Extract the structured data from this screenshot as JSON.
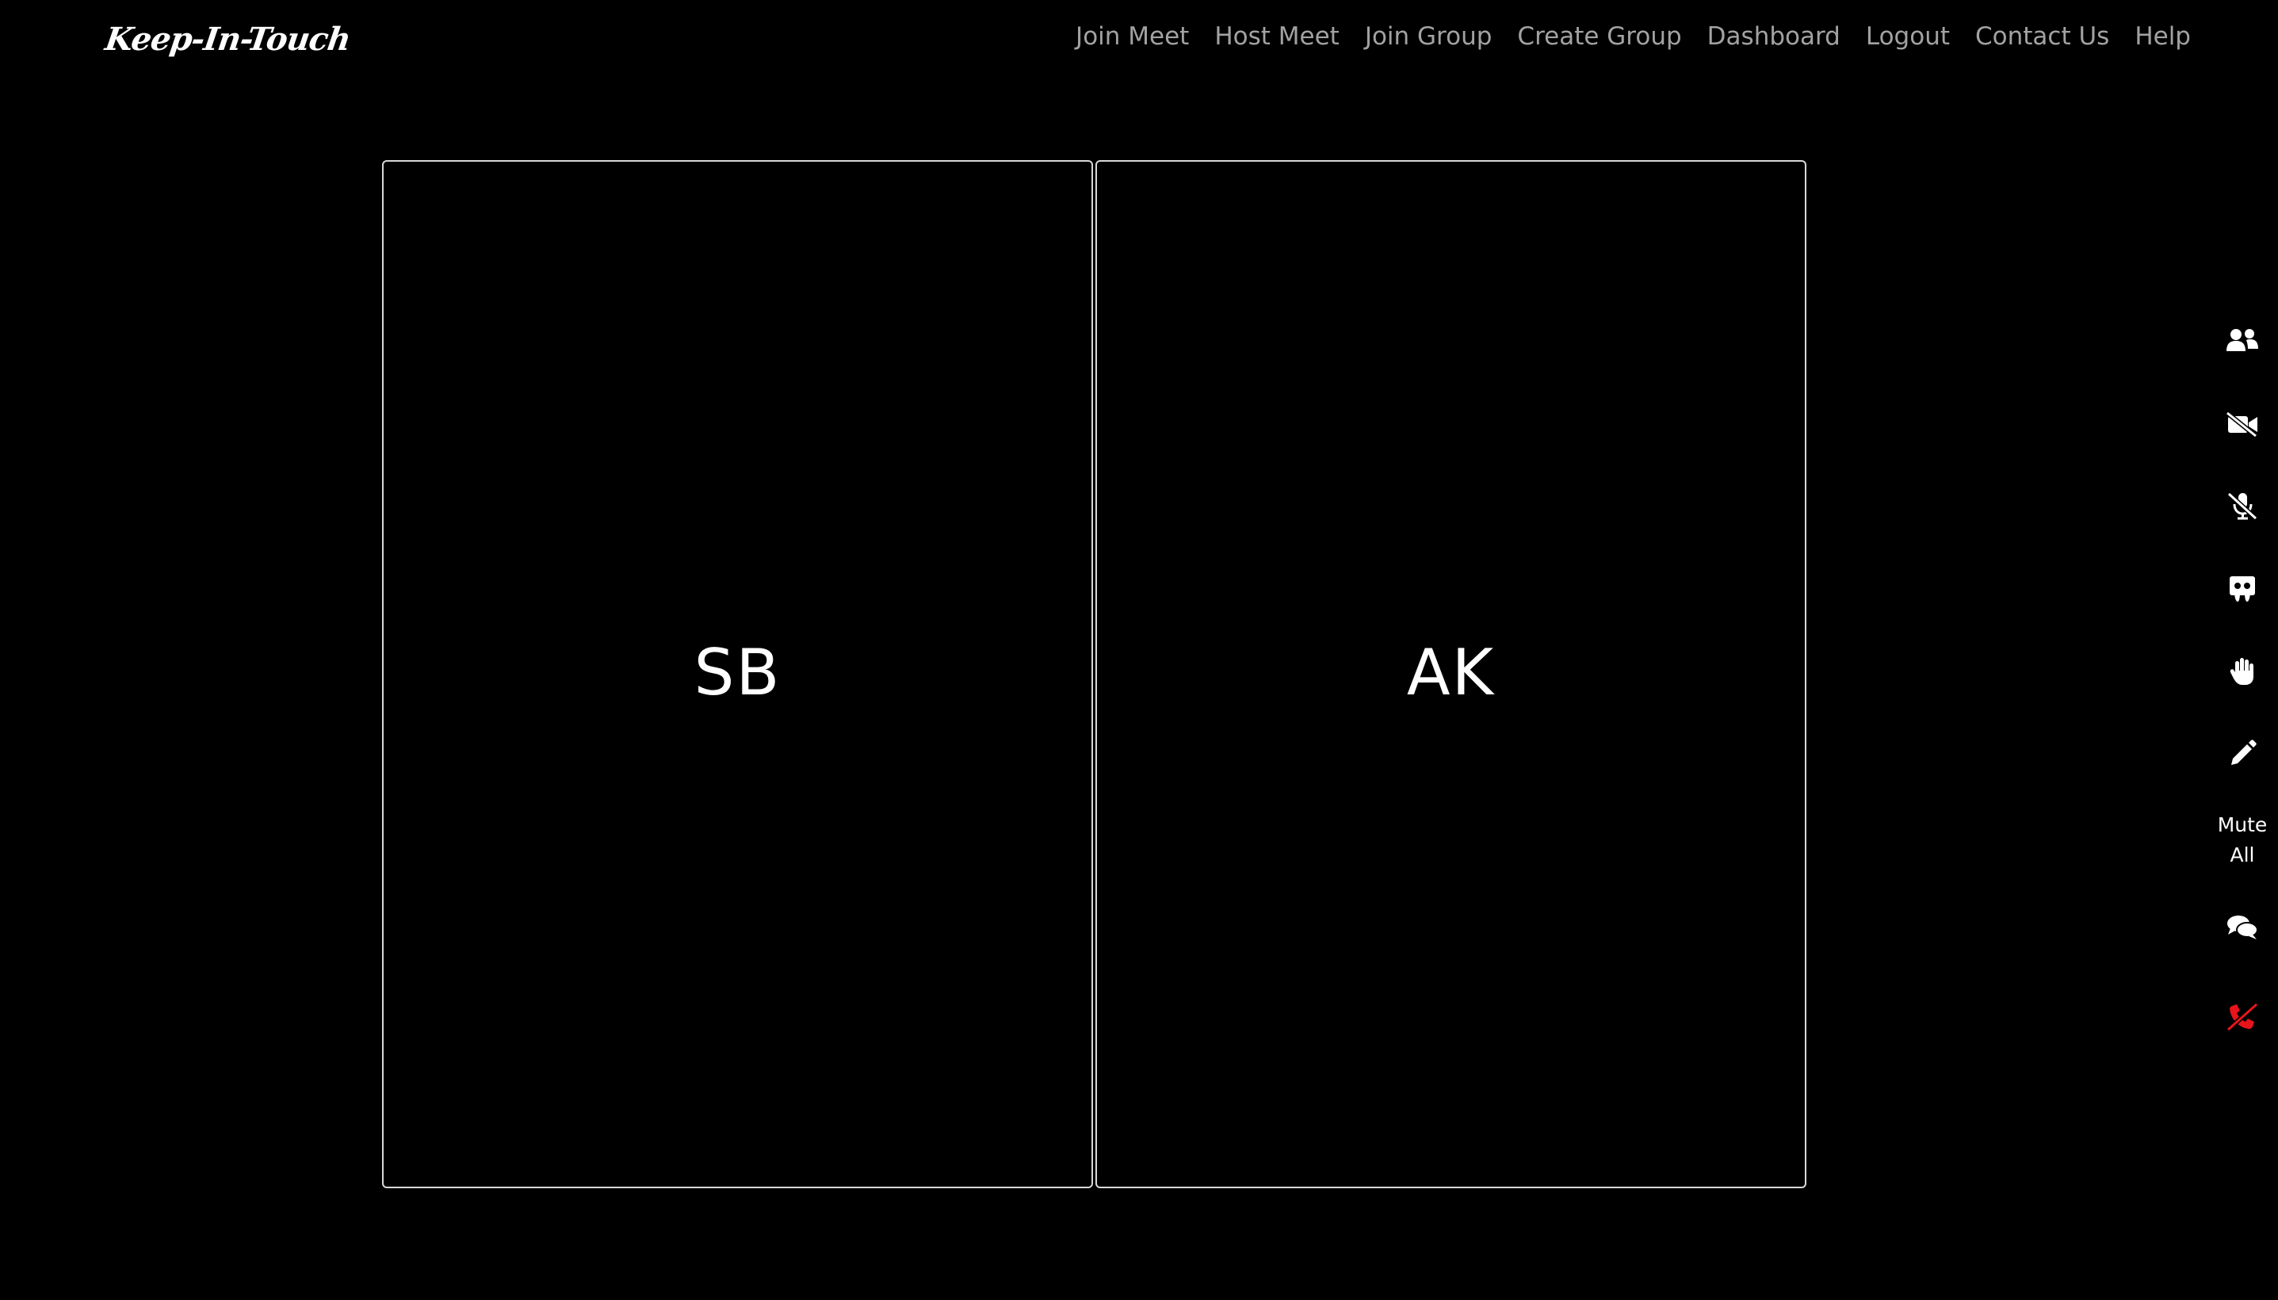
{
  "brand": "Keep-In-Touch",
  "nav": {
    "items": [
      {
        "label": "Join Meet"
      },
      {
        "label": "Host Meet"
      },
      {
        "label": "Join Group"
      },
      {
        "label": "Create Group"
      },
      {
        "label": "Dashboard"
      },
      {
        "label": "Logout"
      },
      {
        "label": "Contact Us"
      },
      {
        "label": "Help"
      }
    ]
  },
  "participants": [
    {
      "initials": "SB"
    },
    {
      "initials": "AK"
    }
  ],
  "controls": {
    "participants_icon": "users-icon",
    "video_icon": "video-slash-icon",
    "mic_icon": "microphone-slash-icon",
    "screen_share_icon": "slideshare-icon",
    "raise_hand_icon": "hand-icon",
    "whiteboard_icon": "pencil-icon",
    "mute_all_line1": "Mute",
    "mute_all_line2": "All",
    "chat_icon": "comments-icon",
    "end_call_icon": "phone-slash-icon",
    "end_call_color": "#e8141b"
  }
}
